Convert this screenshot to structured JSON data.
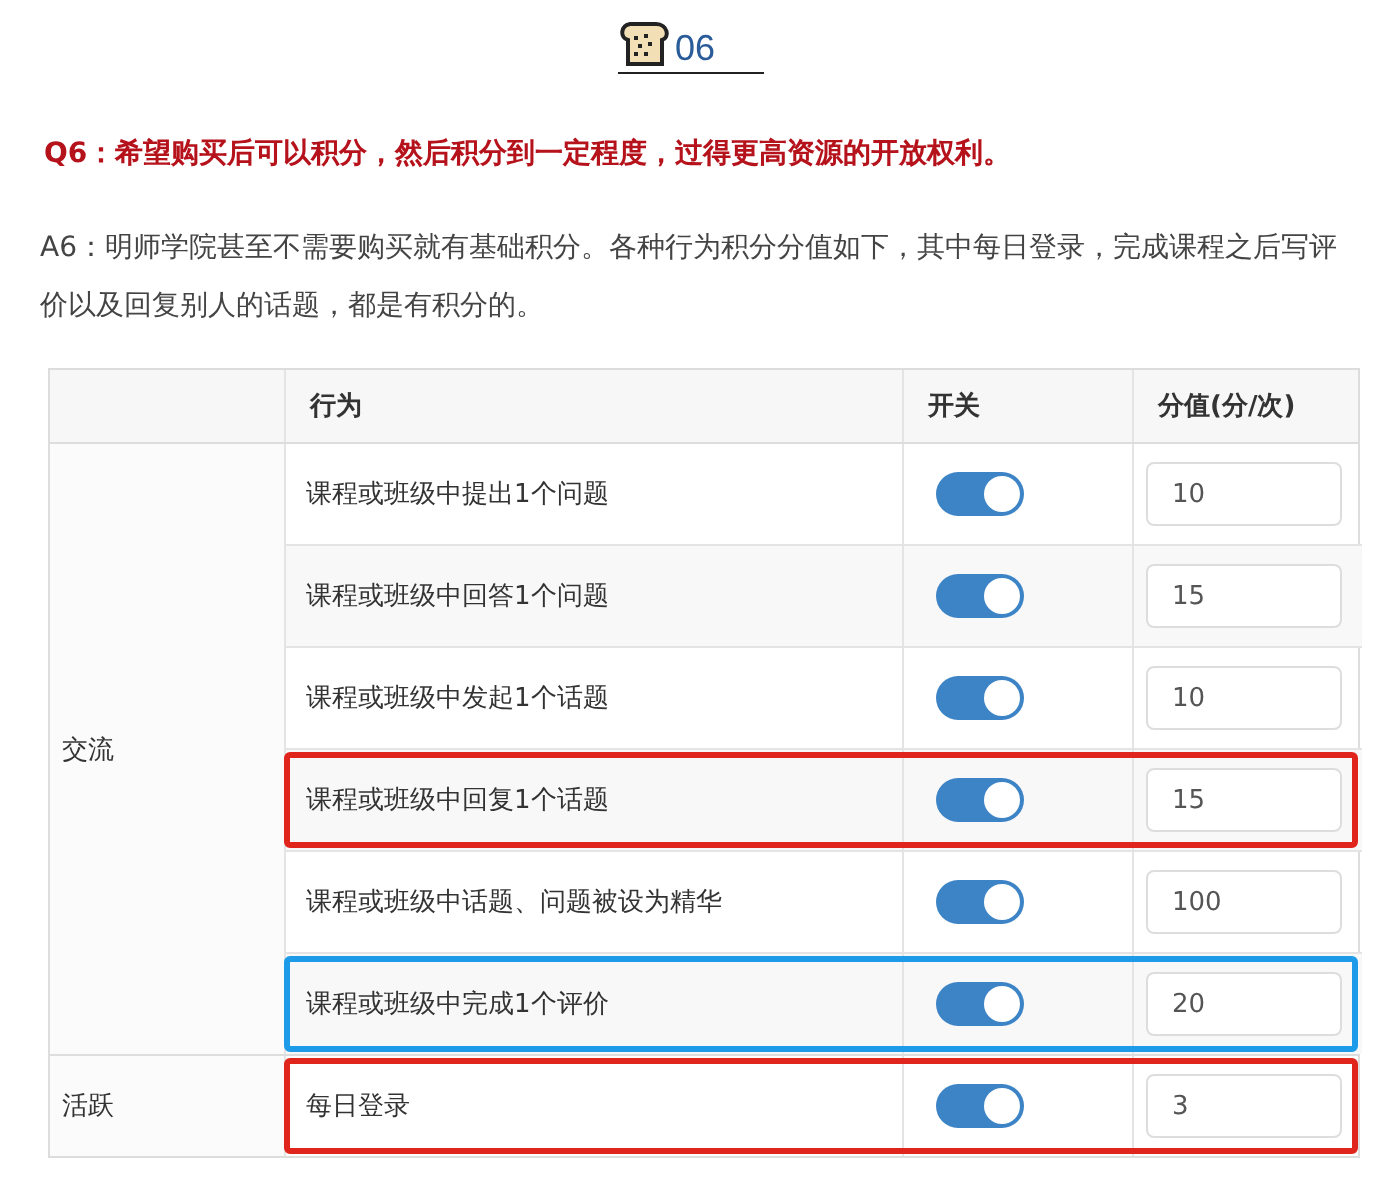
{
  "heading": {
    "number": "06"
  },
  "question": "Q6：希望购买后可以积分，然后积分到一定程度，过得更高资源的开放权利。",
  "answer": "A6：明师学院甚至不需要购买就有基础积分。各种行为积分分值如下，其中每日登录，完成课程之后写评价以及回复别人的话题，都是有积分的。",
  "table": {
    "columns": [
      "行为",
      "开关",
      "分值(分/次)"
    ],
    "groups": [
      {
        "label": "交流",
        "rows": [
          {
            "behavior": "课程或班级中提出1个问题",
            "on": true,
            "value": "10"
          },
          {
            "behavior": "课程或班级中回答1个问题",
            "on": true,
            "value": "15"
          },
          {
            "behavior": "课程或班级中发起1个话题",
            "on": true,
            "value": "10"
          },
          {
            "behavior": "课程或班级中回复1个话题",
            "on": true,
            "value": "15",
            "color": "#e0261c"
          },
          {
            "behavior": "课程或班级中话题、问题被设为精华",
            "on": true,
            "value": "100"
          },
          {
            "behavior": "课程或班级中完成1个评价",
            "on": true,
            "value": "20",
            "color": "#1e9be8"
          }
        ]
      },
      {
        "label": "活跃",
        "rows": [
          {
            "behavior": "每日登录",
            "on": true,
            "value": "3",
            "color": "#e0261c"
          }
        ]
      }
    ]
  }
}
